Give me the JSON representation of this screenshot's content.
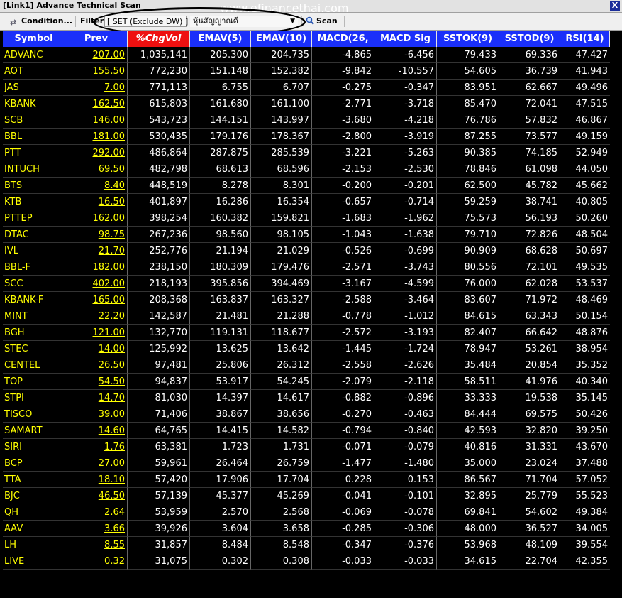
{
  "window": {
    "title": "[Link1] Advance Technical Scan",
    "watermark": "www.efinancethai.com",
    "close_label": "X"
  },
  "toolbar": {
    "condition_label": "Condition...",
    "filter_label": "Filter :",
    "filter_value": "[ SET (Exclude DW) ]",
    "select_value": "หุ้นสัญญาณดี",
    "scan_label": "Scan"
  },
  "columns": [
    "Symbol",
    "Prev",
    "%ChgVol",
    "EMAV(5)",
    "EMAV(10)",
    "MACD(26,",
    "MACD Sig",
    "SSTOK(9)",
    "SSTOD(9)",
    "RSI(14)"
  ],
  "rows": [
    [
      "ADVANC",
      "207.00",
      "1,035,141",
      "205.300",
      "204.735",
      "-4.865",
      "-6.456",
      "79.433",
      "69.336",
      "47.427"
    ],
    [
      "AOT",
      "155.50",
      "772,230",
      "151.148",
      "152.382",
      "-9.842",
      "-10.557",
      "54.605",
      "36.739",
      "41.943"
    ],
    [
      "JAS",
      "7.00",
      "771,113",
      "6.755",
      "6.707",
      "-0.275",
      "-0.347",
      "83.951",
      "62.667",
      "49.496"
    ],
    [
      "KBANK",
      "162.50",
      "615,803",
      "161.680",
      "161.100",
      "-2.771",
      "-3.718",
      "85.470",
      "72.041",
      "47.515"
    ],
    [
      "SCB",
      "146.00",
      "543,723",
      "144.151",
      "143.997",
      "-3.680",
      "-4.218",
      "76.786",
      "57.832",
      "46.867"
    ],
    [
      "BBL",
      "181.00",
      "530,435",
      "179.176",
      "178.367",
      "-2.800",
      "-3.919",
      "87.255",
      "73.577",
      "49.159"
    ],
    [
      "PTT",
      "292.00",
      "486,864",
      "287.875",
      "285.539",
      "-3.221",
      "-5.263",
      "90.385",
      "74.185",
      "52.949"
    ],
    [
      "INTUCH",
      "69.50",
      "482,798",
      "68.613",
      "68.596",
      "-2.153",
      "-2.530",
      "78.846",
      "61.098",
      "44.050"
    ],
    [
      "BTS",
      "8.40",
      "448,519",
      "8.278",
      "8.301",
      "-0.200",
      "-0.201",
      "62.500",
      "45.782",
      "45.662"
    ],
    [
      "KTB",
      "16.50",
      "401,897",
      "16.286",
      "16.354",
      "-0.657",
      "-0.714",
      "59.259",
      "38.741",
      "40.805"
    ],
    [
      "PTTEP",
      "162.00",
      "398,254",
      "160.382",
      "159.821",
      "-1.683",
      "-1.962",
      "75.573",
      "56.193",
      "50.260"
    ],
    [
      "DTAC",
      "98.75",
      "267,236",
      "98.560",
      "98.105",
      "-1.043",
      "-1.638",
      "79.710",
      "72.826",
      "48.504"
    ],
    [
      "IVL",
      "21.70",
      "252,776",
      "21.194",
      "21.029",
      "-0.526",
      "-0.699",
      "90.909",
      "68.628",
      "50.697"
    ],
    [
      "BBL-F",
      "182.00",
      "238,150",
      "180.309",
      "179.476",
      "-2.571",
      "-3.743",
      "80.556",
      "72.101",
      "49.535"
    ],
    [
      "SCC",
      "402.00",
      "218,193",
      "395.856",
      "394.469",
      "-3.167",
      "-4.599",
      "76.000",
      "62.028",
      "53.537"
    ],
    [
      "KBANK-F",
      "165.00",
      "208,368",
      "163.837",
      "163.327",
      "-2.588",
      "-3.464",
      "83.607",
      "71.972",
      "48.469"
    ],
    [
      "MINT",
      "22.20",
      "142,587",
      "21.481",
      "21.288",
      "-0.778",
      "-1.012",
      "84.615",
      "63.343",
      "50.154"
    ],
    [
      "BGH",
      "121.00",
      "132,770",
      "119.131",
      "118.677",
      "-2.572",
      "-3.193",
      "82.407",
      "66.642",
      "48.876"
    ],
    [
      "STEC",
      "14.00",
      "125,992",
      "13.625",
      "13.642",
      "-1.445",
      "-1.724",
      "78.947",
      "53.261",
      "38.954"
    ],
    [
      "CENTEL",
      "26.50",
      "97,481",
      "25.806",
      "26.312",
      "-2.558",
      "-2.626",
      "35.484",
      "20.854",
      "35.352"
    ],
    [
      "TOP",
      "54.50",
      "94,837",
      "53.917",
      "54.245",
      "-2.079",
      "-2.118",
      "58.511",
      "41.976",
      "40.340"
    ],
    [
      "STPI",
      "14.70",
      "81,030",
      "14.397",
      "14.617",
      "-0.882",
      "-0.896",
      "33.333",
      "19.538",
      "35.145"
    ],
    [
      "TISCO",
      "39.00",
      "71,406",
      "38.867",
      "38.656",
      "-0.270",
      "-0.463",
      "84.444",
      "69.575",
      "50.426"
    ],
    [
      "SAMART",
      "14.60",
      "64,765",
      "14.415",
      "14.582",
      "-0.794",
      "-0.840",
      "42.593",
      "32.820",
      "39.250"
    ],
    [
      "SIRI",
      "1.76",
      "63,381",
      "1.723",
      "1.731",
      "-0.071",
      "-0.079",
      "40.816",
      "31.331",
      "43.670"
    ],
    [
      "BCP",
      "27.00",
      "59,961",
      "26.464",
      "26.759",
      "-1.477",
      "-1.480",
      "35.000",
      "23.024",
      "37.488"
    ],
    [
      "TTA",
      "18.10",
      "57,420",
      "17.906",
      "17.704",
      "0.228",
      "0.153",
      "86.567",
      "71.704",
      "57.052"
    ],
    [
      "BJC",
      "46.50",
      "57,139",
      "45.377",
      "45.269",
      "-0.041",
      "-0.101",
      "32.895",
      "25.779",
      "55.523"
    ],
    [
      "QH",
      "2.64",
      "53,959",
      "2.570",
      "2.568",
      "-0.069",
      "-0.078",
      "69.841",
      "54.602",
      "49.384"
    ],
    [
      "AAV",
      "3.66",
      "39,926",
      "3.604",
      "3.658",
      "-0.285",
      "-0.306",
      "48.000",
      "36.527",
      "34.005"
    ],
    [
      "LH",
      "8.55",
      "31,857",
      "8.484",
      "8.548",
      "-0.347",
      "-0.376",
      "53.968",
      "48.109",
      "39.554"
    ],
    [
      "LIVE",
      "0.32",
      "31,075",
      "0.302",
      "0.308",
      "-0.033",
      "-0.033",
      "34.615",
      "22.704",
      "42.355"
    ]
  ],
  "colors": {
    "header_bg": "#1a2ffa",
    "highlight_header_bg": "#ee1010",
    "symbol_text": "#ffff00",
    "value_text": "#ffffff",
    "background": "#000000"
  }
}
